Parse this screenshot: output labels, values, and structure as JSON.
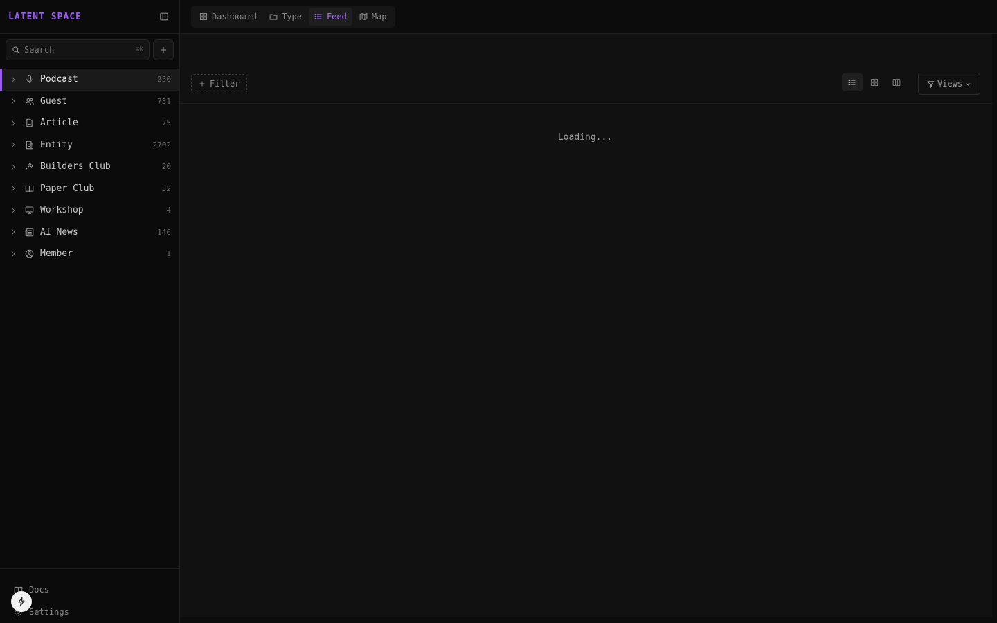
{
  "brand": {
    "name": "LATENT SPACE"
  },
  "search": {
    "placeholder": "Search",
    "shortcut": "⌘K"
  },
  "sidebar": {
    "items": [
      {
        "label": "Podcast",
        "count": "250",
        "icon": "microphone-icon",
        "active": true
      },
      {
        "label": "Guest",
        "count": "731",
        "icon": "users-icon"
      },
      {
        "label": "Article",
        "count": "75",
        "icon": "document-icon"
      },
      {
        "label": "Entity",
        "count": "2702",
        "icon": "building-icon"
      },
      {
        "label": "Builders Club",
        "count": "20",
        "icon": "hammer-icon"
      },
      {
        "label": "Paper Club",
        "count": "32",
        "icon": "book-open-icon"
      },
      {
        "label": "Workshop",
        "count": "4",
        "icon": "presentation-icon"
      },
      {
        "label": "AI News",
        "count": "146",
        "icon": "newspaper-icon"
      },
      {
        "label": "Member",
        "count": "1",
        "icon": "user-circle-icon"
      }
    ],
    "footer": [
      {
        "label": "Docs",
        "icon": "book-open-icon"
      },
      {
        "label": "Settings",
        "icon": "gear-icon"
      }
    ]
  },
  "tabs": [
    {
      "label": "Dashboard",
      "icon": "grid-icon"
    },
    {
      "label": "Type",
      "icon": "folder-icon"
    },
    {
      "label": "Feed",
      "icon": "list-icon",
      "active": true
    },
    {
      "label": "Map",
      "icon": "map-icon"
    }
  ],
  "toolbar": {
    "filter_label": "Filter",
    "views_label": "Views"
  },
  "main": {
    "loading_text": "Loading..."
  },
  "colors": {
    "accent": "#9b5cf6",
    "background": "#0c0c0c",
    "panel": "#111111"
  }
}
